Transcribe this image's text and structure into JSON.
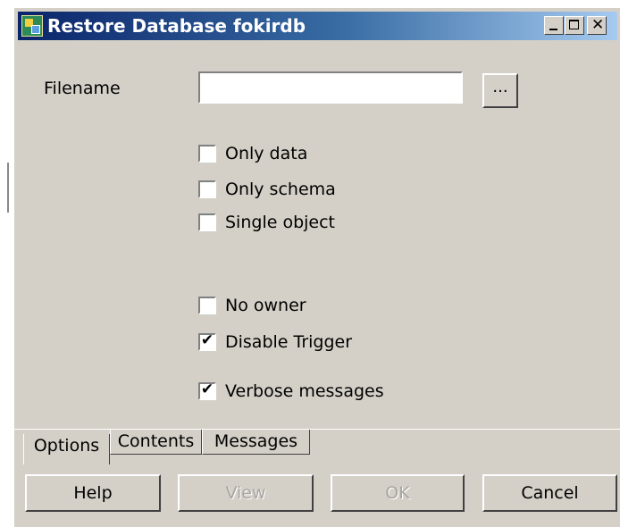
{
  "window": {
    "title": "Restore Database fokirdb"
  },
  "form": {
    "filename_label": "Filename",
    "filename_value": "",
    "browse_label": "..."
  },
  "options": [
    {
      "label": "Only data",
      "checked": false
    },
    {
      "label": "Only schema",
      "checked": false
    },
    {
      "label": "Single object",
      "checked": false
    },
    {
      "label": "No owner",
      "checked": false
    },
    {
      "label": "Disable Trigger",
      "checked": true
    },
    {
      "label": "Verbose messages",
      "checked": true
    }
  ],
  "tabs": [
    {
      "label": "Options",
      "active": true
    },
    {
      "label": "Contents",
      "active": false
    },
    {
      "label": "Messages",
      "active": false
    }
  ],
  "buttons": {
    "help": "Help",
    "view": "View",
    "ok": "OK",
    "cancel": "Cancel"
  },
  "check_mark": "✔"
}
